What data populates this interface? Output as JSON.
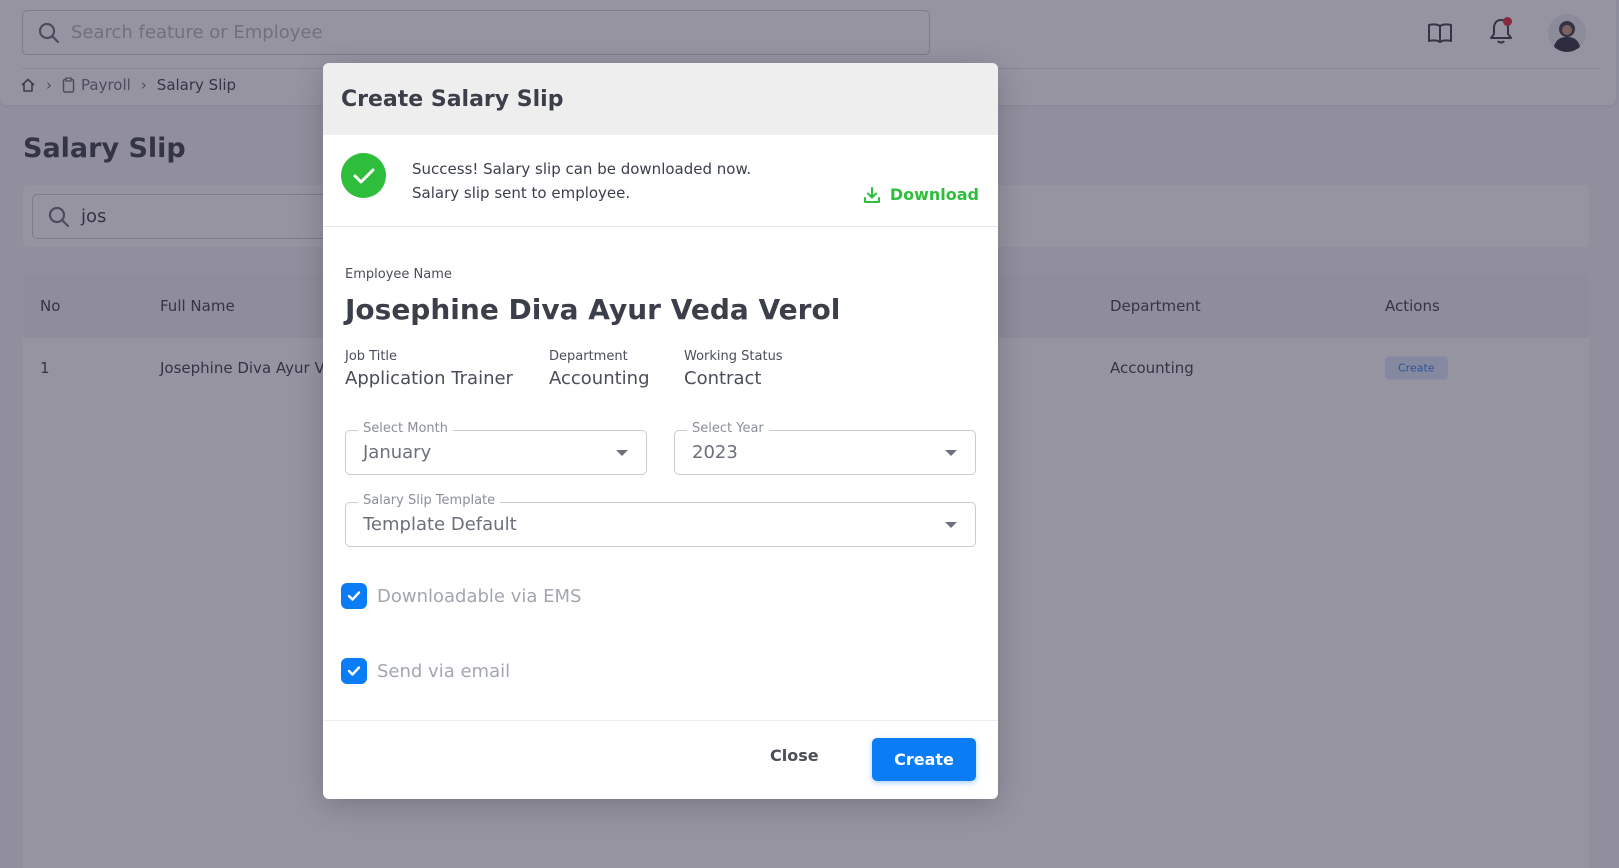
{
  "header": {
    "search_placeholder": "Search feature or Employee",
    "icons": [
      "book-icon",
      "bell-icon",
      "avatar"
    ],
    "notification_dot_color": "#e5243b"
  },
  "breadcrumb": {
    "items": [
      "Payroll",
      "Salary Slip"
    ]
  },
  "page": {
    "title": "Salary Slip",
    "search_value": "jos"
  },
  "table": {
    "headers": {
      "no": "No",
      "full_name": "Full Name",
      "department": "Department",
      "actions": "Actions"
    },
    "rows": [
      {
        "no": "1",
        "full_name": "Josephine Diva Ayur V",
        "department": "Accounting",
        "action_label": "Create"
      }
    ]
  },
  "modal": {
    "title": "Create Salary Slip",
    "success_line1": "Success! Salary slip can be downloaded now.",
    "success_line2": "Salary slip sent to employee.",
    "download_label": "Download",
    "employee_label": "Employee Name",
    "employee_name": "Josephine Diva Ayur Veda Verol",
    "job_title_label": "Job Title",
    "job_title": "Application Trainer",
    "department_label": "Department",
    "department": "Accounting",
    "working_status_label": "Working Status",
    "working_status": "Contract",
    "month_label": "Select Month",
    "month_value": "January",
    "year_label": "Select Year",
    "year_value": "2023",
    "template_label": "Salary Slip Template",
    "template_value": "Template Default",
    "checkbox_ems_label": "Downloadable via EMS",
    "checkbox_ems_checked": true,
    "checkbox_email_label": "Send via email",
    "checkbox_email_checked": true,
    "close_label": "Close",
    "create_label": "Create"
  },
  "colors": {
    "primary": "#0a7cf5",
    "success": "#2fbe3c",
    "overlay": "rgba(45, 42, 68, 0.5)"
  }
}
